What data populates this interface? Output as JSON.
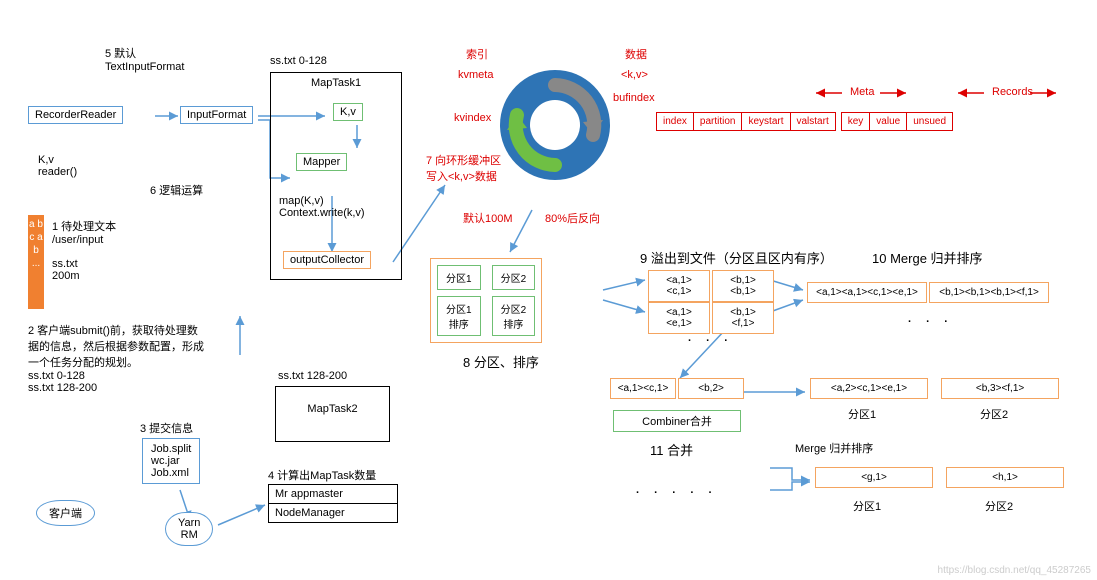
{
  "step5": "5 默认\nTextInputFormat",
  "recorderReader": "RecorderReader",
  "inputFormat": "InputFormat",
  "kvReader": "K,v\nreader()",
  "step6": "6 逻辑运算",
  "orangeCol": "a b c a b ...",
  "step1": "1 待处理文本\n/user/input",
  "ssFile": "ss.txt\n200m",
  "step2": "2 客户端submit()前，获取待处理数据的信息，然后根据参数配置，形成一个任务分配的规划。\nss.txt 0-128\nss.txt 128-200",
  "step3": "3 提交信息",
  "jobFiles": "Job.split\nwc.jar\nJob.xml",
  "client": "客户端",
  "yarnRM": "Yarn\nRM",
  "step4": "4 计算出MapTask数量",
  "appmaster": "Mr appmaster",
  "nodeManager": "NodeManager",
  "splitRange1": "ss.txt 0-128",
  "task1": {
    "name": "MapTask1",
    "kv": "K,v",
    "mapper": "Mapper",
    "mapFn": "map(K,v)\nContext.write(k,v)",
    "output": "outputCollector"
  },
  "splitRange2": "ss.txt 128-200",
  "task2": "MapTask2",
  "ring": {
    "suoyin": "索引",
    "kvmeta": "kvmeta",
    "kvindex": "kvindex",
    "step7": "7 向环形缓冲区\n写入<k,v>数据",
    "default": "默认100M",
    "reverse": "80%后反向",
    "shuju": "数据",
    "kv": "<k,v>",
    "bufindex": "bufindex"
  },
  "meta": "Meta",
  "records": "Records",
  "tblHeaders": [
    "index",
    "partition",
    "keystart",
    "valstart",
    "key",
    "value",
    "unsued"
  ],
  "partition": {
    "p1": "分区1",
    "p2": "分区2",
    "p1s": "分区1\n排序",
    "p2s": "分区2\n排序"
  },
  "step8": "8 分区、排序",
  "step9": "9 溢出到文件（分区且区内有序）",
  "spill": {
    "r1a": "<a,1> <c,1>",
    "r1b": "<b,1><b,1>",
    "r2a": "<a,1> <e,1>",
    "r2b": "<b,1> <f,1>"
  },
  "step10": "10 Merge 归并排序",
  "merge1": {
    "a": "<a,1><a,1><c,1><e,1>",
    "b": "<b,1><b,1><b,1><f,1>"
  },
  "combiner": {
    "a": "<a,1><c,1>",
    "b": "<b,2>",
    "box": "Combiner合并"
  },
  "step11": "11 合并",
  "merge2Title": "Merge 归并排序",
  "merge2": {
    "p1": "<a,2><c,1><e,1>",
    "p2": "<b,3><f,1>"
  },
  "merge3": {
    "g": "<g,1>",
    "h": "<h,1>"
  },
  "pLabel1": "分区1",
  "pLabel2": "分区2",
  "watermark": "https://blog.csdn.net/qq_45287265"
}
